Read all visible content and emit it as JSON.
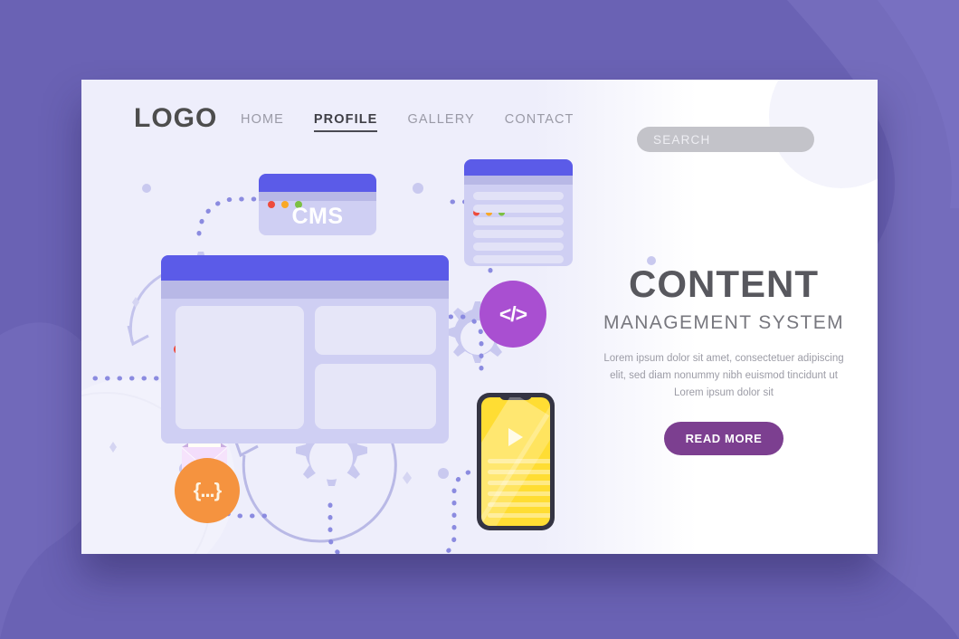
{
  "theme": {
    "page_background": "#6a62b4",
    "card_background": "#ffffff",
    "card_tint": "#eeeefb",
    "accent_indigo": "#5b5be8",
    "accent_purple": "#a94fd1",
    "accent_orange": "#f5933f",
    "accent_yellow": "#ffdd33",
    "button_purple": "#7c3f90",
    "heading_gray": "#58585e"
  },
  "header": {
    "logo": "LOGO",
    "nav": [
      {
        "label": "HOME",
        "active": false
      },
      {
        "label": "PROFILE",
        "active": true
      },
      {
        "label": "GALLERY",
        "active": false
      },
      {
        "label": "CONTACT",
        "active": false
      }
    ],
    "search": {
      "value": "",
      "placeholder": "SEARCH"
    }
  },
  "hero": {
    "title": "CONTENT",
    "subtitle": "MANAGEMENT SYSTEM",
    "body": "Lorem ipsum dolor sit amet, consectetuer adipiscing elit, sed diam nonummy nibh euismod tincidunt ut Lorem ipsum dolor sit",
    "cta_label": "READ MORE"
  },
  "illustration": {
    "cms_window": {
      "label": "CMS",
      "traffic_lights": [
        "red",
        "yellow",
        "green"
      ]
    },
    "document_window": {
      "traffic_lights": [
        "red",
        "yellow",
        "green"
      ],
      "text_lines": 6
    },
    "main_window": {
      "traffic_lights": [
        "red",
        "yellow",
        "green"
      ],
      "panels": 3
    },
    "code_badge": {
      "glyph": "</>"
    },
    "json_badge": {
      "glyph": "{...}"
    },
    "phone": {
      "screen_lines": 7
    },
    "envelope": {
      "name": "mail"
    },
    "gears": 3
  }
}
